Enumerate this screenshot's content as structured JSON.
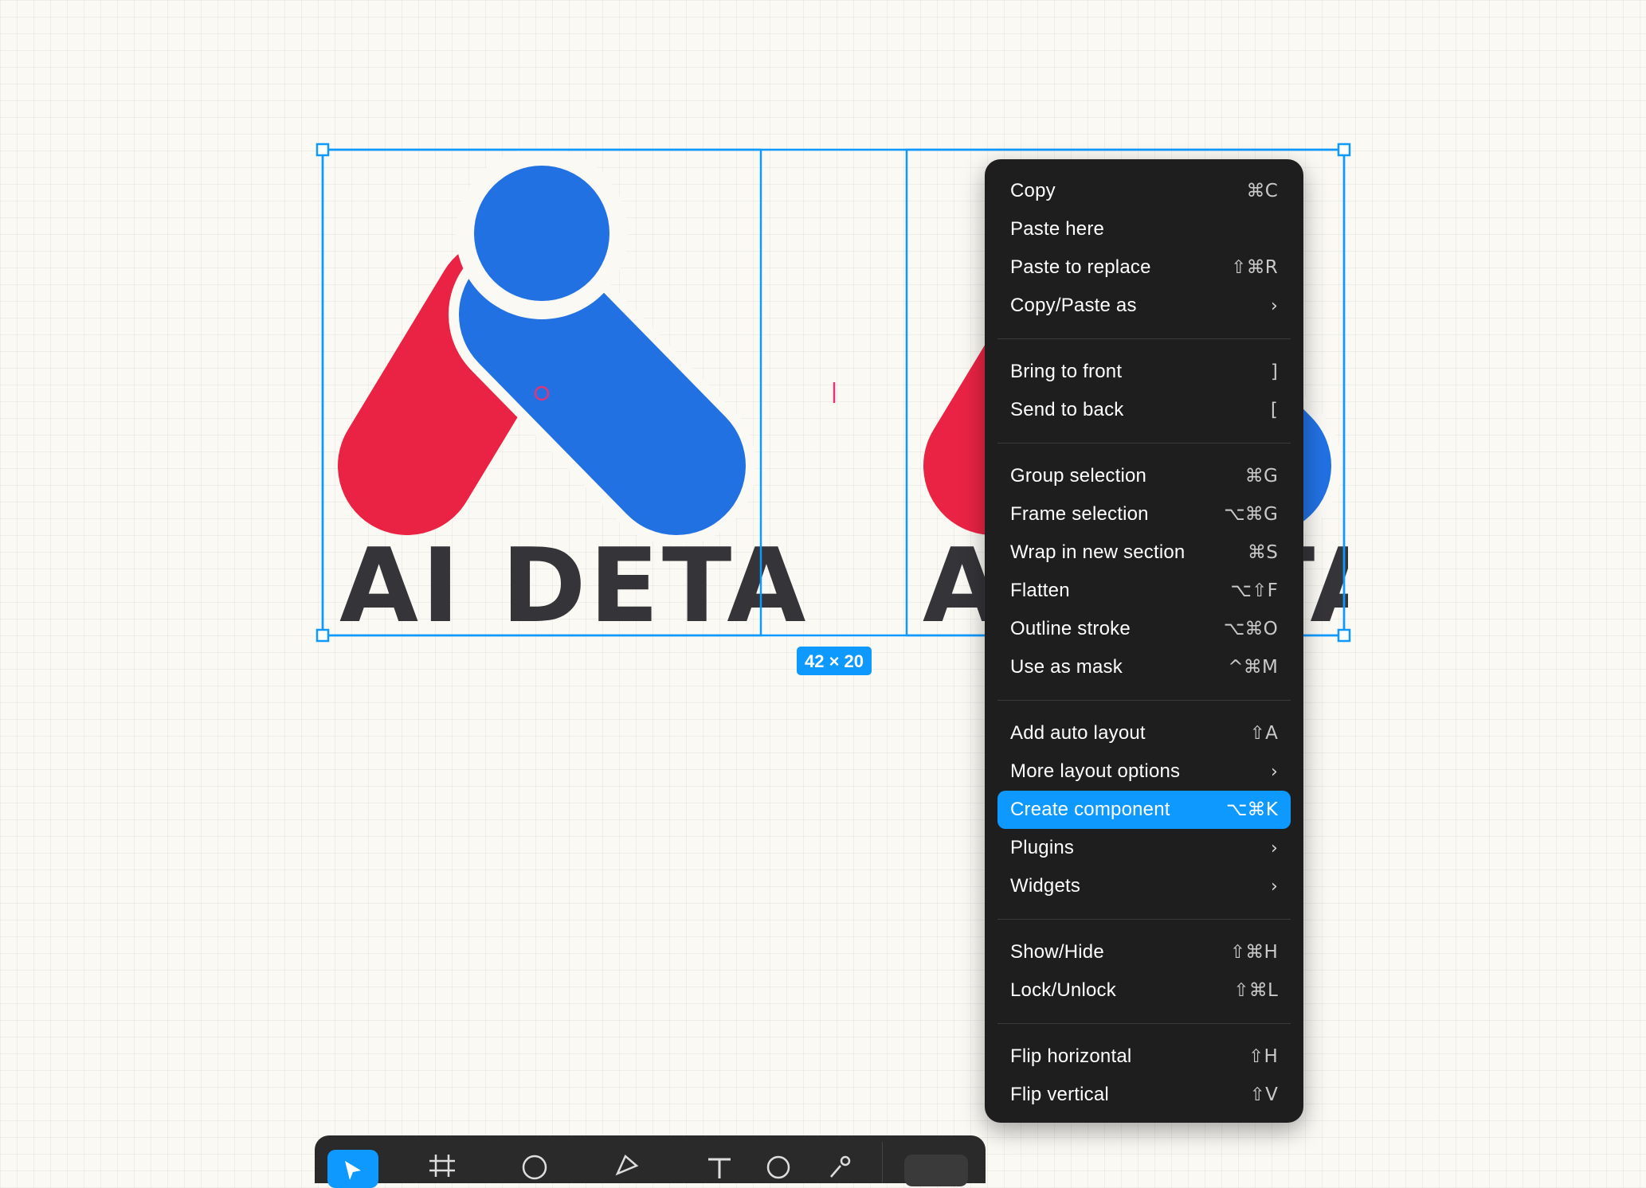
{
  "canvas": {
    "logo_left": {
      "text": "AI DETA"
    },
    "logo_right": {
      "text": "AI DETA"
    },
    "dimension_badge": "42 × 20"
  },
  "context_menu": {
    "groups": [
      [
        {
          "label": "Copy",
          "shortcut": "⌘C"
        },
        {
          "label": "Paste here",
          "shortcut": ""
        },
        {
          "label": "Paste to replace",
          "shortcut": "⇧⌘R"
        },
        {
          "label": "Copy/Paste as",
          "submenu": true,
          "chevron": "›"
        }
      ],
      [
        {
          "label": "Bring to front",
          "shortcut": "]"
        },
        {
          "label": "Send to back",
          "shortcut": "["
        }
      ],
      [
        {
          "label": "Group selection",
          "shortcut": "⌘G"
        },
        {
          "label": "Frame selection",
          "shortcut": "⌥⌘G"
        },
        {
          "label": "Wrap in new section",
          "shortcut": "⌘S"
        },
        {
          "label": "Flatten",
          "shortcut": "⌥⇧F"
        },
        {
          "label": "Outline stroke",
          "shortcut": "⌥⌘O"
        },
        {
          "label": "Use as mask",
          "shortcut": "^⌘M"
        }
      ],
      [
        {
          "label": "Add auto layout",
          "shortcut": "⇧A"
        },
        {
          "label": "More layout options",
          "submenu": true,
          "chevron": "›"
        },
        {
          "label": "Create component",
          "shortcut": "⌥⌘K",
          "highlighted": true
        },
        {
          "label": "Plugins",
          "submenu": true,
          "chevron": "›"
        },
        {
          "label": "Widgets",
          "submenu": true,
          "chevron": "›"
        }
      ],
      [
        {
          "label": "Show/Hide",
          "shortcut": "⇧⌘H"
        },
        {
          "label": "Lock/Unlock",
          "shortcut": "⇧⌘L"
        }
      ],
      [
        {
          "label": "Flip horizontal",
          "shortcut": "⇧H"
        },
        {
          "label": "Flip vertical",
          "shortcut": "⇧V"
        }
      ]
    ]
  },
  "toolbar": {
    "tools": [
      "move-tool-icon",
      "frame-tool-icon",
      "shape-tool-icon",
      "pen-tool-icon",
      "text-tool-icon",
      "comment-tool-icon",
      "actions-icon"
    ]
  },
  "colors": {
    "canvas_bg": "#fbf9f4",
    "selection": "#0d99ff",
    "logo_red": "#ea2344",
    "logo_blue": "#2271e3",
    "logo_text": "#353539",
    "menu_bg": "#1e1e1e",
    "menu_highlight": "#0d99ff",
    "measure_pink": "#e0357a"
  }
}
